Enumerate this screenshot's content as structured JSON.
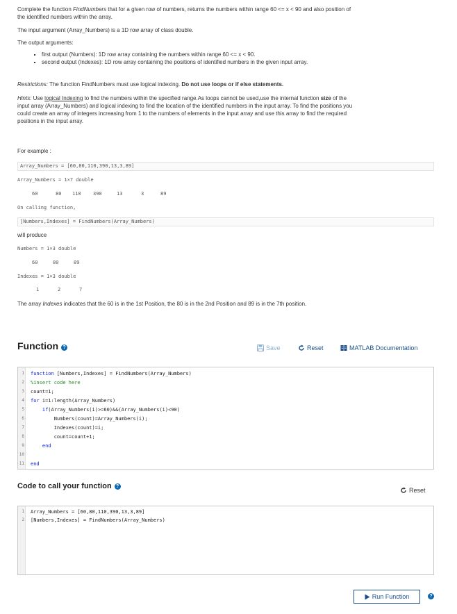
{
  "intro": {
    "line1_a": "Complete the function ",
    "line1_em": "FindNumbers",
    "line1_b": " that for a given row of numbers, returns the numbers within range 60 <= x < 90 and also position of",
    "line2": "the identified numbers within the array.",
    "input_arg": "The input argument (Array_Numbers) is a 1D row array of class double.",
    "output_args": "The output arguments:",
    "bullet1": "first output (Numbers): 1D row array containing the numbers within range 60 <= x < 90.",
    "bullet2": "second output (Indexes): 1D row array containing the positions of identified numbers in the given input array."
  },
  "restrictions": {
    "label": "Restrictions:",
    "text": " The function FindNumbers must use logical indexing. ",
    "bold": "Do not use loops or if else statements."
  },
  "hints": {
    "label": "Hints:",
    "pre": " Use ",
    "link": "logical Indexing",
    "post1": " to find the numbers within the specified range.As loops cannot be used,use the internal function ",
    "size_kw": "size",
    "post2": " of the",
    "line2": "input array (Array_Numbers) and logical indexing to find the location of the identified numbers in the input array. To find the positions you",
    "line3": "could create an array of integers increasing from 1 to the numbers of elements in the input array and use this array to find the required",
    "line4": "positions in the input array."
  },
  "example": {
    "heading": "For example :",
    "cmd1": "Array_Numbers = [60,80,110,390,13,3,89]",
    "out1": "Array_Numbers = 1×7 double",
    "vals1": [
      "60",
      "80",
      "110",
      "390",
      "13",
      "3",
      "89"
    ],
    "calling": "On calling function,",
    "cmd2": "[Numbers,Indexes] = FindNumbers(Array_Numbers)",
    "produce": "will produce",
    "out2": "Numbers = 1×3 double",
    "vals2": [
      "60",
      "80",
      "89"
    ],
    "out3": "Indexes = 1×3 double",
    "vals3": [
      "1",
      "2",
      "7"
    ],
    "explain_a": "The array ",
    "explain_em": "Indexes",
    "explain_b": " indicates that the 60 is in the 1st Position, the 80 is in the 2nd Position and 89 is in the 7th position."
  },
  "function_section": {
    "title": "Function",
    "save": "Save",
    "reset": "Reset",
    "docs": "MATLAB Documentation",
    "lines": [
      {
        "n": "1",
        "parts": [
          {
            "c": "kw",
            "t": "function"
          },
          {
            "c": "",
            "t": " [Numbers,Indexes] = FindNumbers(Array_Numbers)"
          }
        ]
      },
      {
        "n": "2",
        "parts": [
          {
            "c": "cm",
            "t": "%insert code here"
          }
        ]
      },
      {
        "n": "3",
        "parts": [
          {
            "c": "",
            "t": "count=1;"
          }
        ]
      },
      {
        "n": "4",
        "parts": [
          {
            "c": "kw",
            "t": "for"
          },
          {
            "c": "",
            "t": " i=1:length(Array_Numbers)"
          }
        ]
      },
      {
        "n": "5",
        "parts": [
          {
            "c": "",
            "t": "    "
          },
          {
            "c": "kw",
            "t": "if"
          },
          {
            "c": "",
            "t": "(Array_Numbers(i)>=60)&&(Array_Numbers(i)<90)"
          }
        ]
      },
      {
        "n": "6",
        "parts": [
          {
            "c": "",
            "t": "        Numbers(count)=Array_Numbers(i);"
          }
        ]
      },
      {
        "n": "7",
        "parts": [
          {
            "c": "",
            "t": "        Indexes(count)=i;"
          }
        ]
      },
      {
        "n": "8",
        "parts": [
          {
            "c": "",
            "t": "        count=count+1;"
          }
        ]
      },
      {
        "n": "9",
        "parts": [
          {
            "c": "",
            "t": "    "
          },
          {
            "c": "kw",
            "t": "end"
          }
        ]
      },
      {
        "n": "10",
        "parts": [
          {
            "c": "",
            "t": ""
          }
        ]
      },
      {
        "n": "11",
        "parts": [
          {
            "c": "kw",
            "t": "end"
          }
        ]
      }
    ]
  },
  "call_section": {
    "title": "Code to call your function",
    "reset": "Reset",
    "lines": [
      {
        "n": "1",
        "parts": [
          {
            "c": "",
            "t": "Array_Numbers = [60,80,110,390,13,3,89]"
          }
        ]
      },
      {
        "n": "2",
        "parts": [
          {
            "c": "",
            "t": "[Numbers,Indexes] = FindNumbers(Array_Numbers)"
          }
        ]
      }
    ],
    "run": "Run Function"
  },
  "colors": {
    "accent": "#0a67b4",
    "keyword": "#0b21e0",
    "comment": "#228b22"
  }
}
